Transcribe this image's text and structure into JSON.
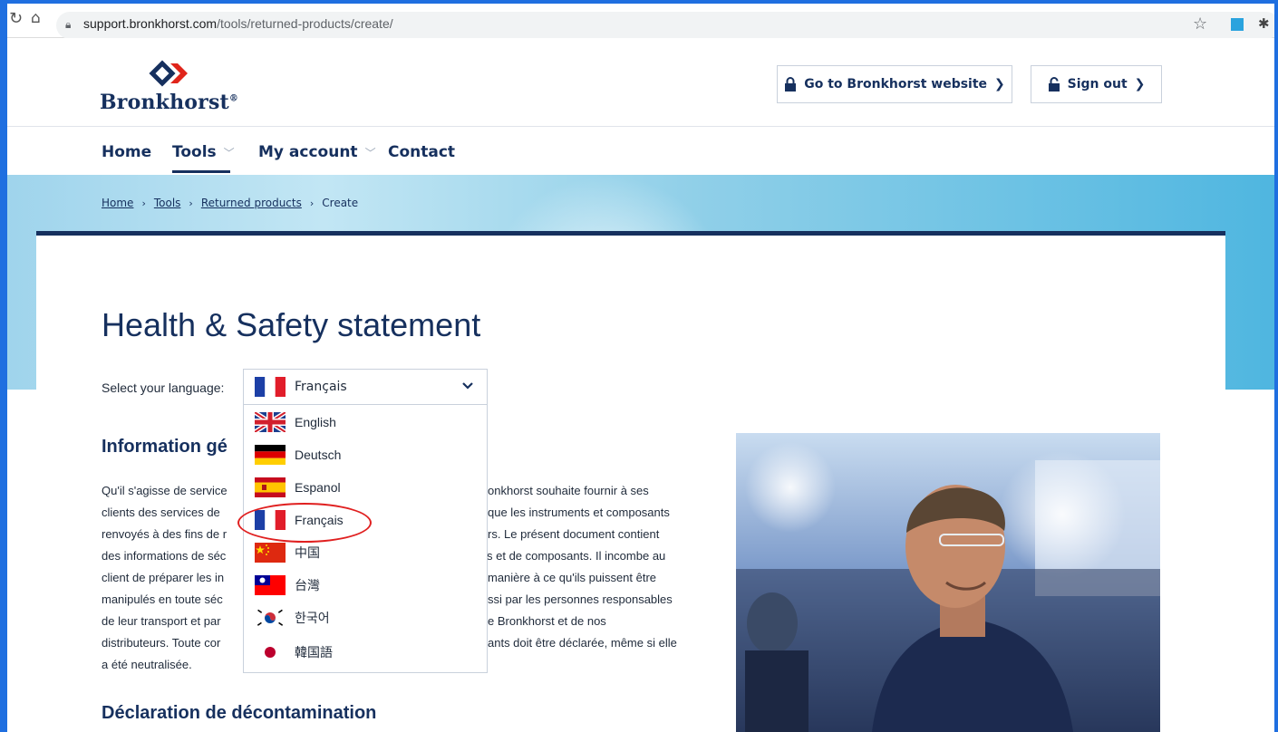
{
  "browser": {
    "url_host": "support.bronkhorst.com",
    "url_path": "/tools/returned-products/create/"
  },
  "header": {
    "logo_text": "Bronkhorst",
    "logo_reg": "®",
    "website_button": "Go to Bronkhorst website",
    "signout_button": "Sign out"
  },
  "nav": {
    "items": [
      {
        "label": "Home",
        "has_menu": false
      },
      {
        "label": "Tools",
        "has_menu": true
      },
      {
        "label": "My account",
        "has_menu": true
      },
      {
        "label": "Contact",
        "has_menu": false
      }
    ]
  },
  "breadcrumb": {
    "items": [
      "Home",
      "Tools",
      "Returned products",
      "Create"
    ]
  },
  "page": {
    "title": "Health & Safety statement",
    "lang_label": "Select your language:",
    "selected_language": "Français"
  },
  "languages": [
    {
      "label": "English",
      "flag": "uk-flag-icon"
    },
    {
      "label": "Deutsch",
      "flag": "germany-flag-icon"
    },
    {
      "label": "Espanol",
      "flag": "spain-flag-icon"
    },
    {
      "label": "Français",
      "flag": "france-flag-icon"
    },
    {
      "label": "中国",
      "flag": "china-flag-icon"
    },
    {
      "label": "台灣",
      "flag": "taiwan-flag-icon"
    },
    {
      "label": "한국어",
      "flag": "korea-flag-icon"
    },
    {
      "label": "韓国語",
      "flag": "japan-flag-icon"
    }
  ],
  "info": {
    "heading": "Information gé",
    "lines_left": [
      "Qu'il s'agisse de service",
      "clients des services de",
      "renvoyés à des fins de r",
      "des informations de séc",
      "client de préparer les in",
      "manipulés en toute séc",
      "de leur transport et par",
      "distributeurs. Toute cor",
      "a été neutralisée."
    ],
    "lines_right": [
      "onkhorst souhaite fournir à ses",
      "que les instruments et composants",
      "rs. Le présent document contient",
      "s et de composants. Il incombe au",
      "manière à ce qu'ils puissent être",
      "ssi par les personnes responsables",
      "e Bronkhorst et de nos",
      "ants doit être déclarée, même si elle",
      ""
    ]
  },
  "decon": {
    "heading": "Déclaration de décontamination"
  },
  "colors": {
    "brand_navy": "#16305e",
    "highlight_red": "#e02020",
    "frame_blue": "#1f6fe0"
  }
}
